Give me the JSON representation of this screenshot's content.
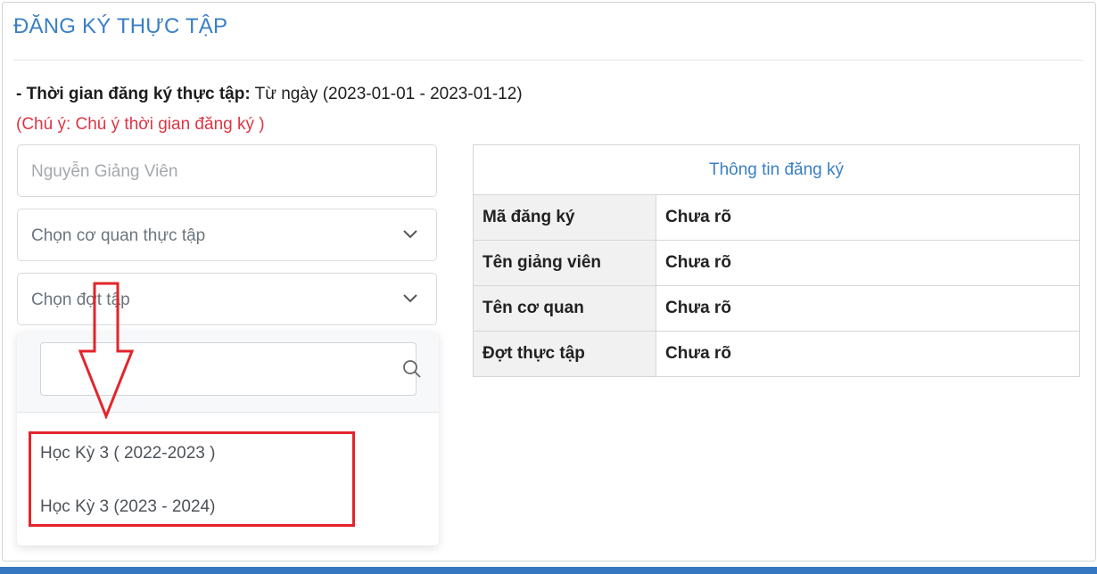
{
  "page": {
    "title": "ĐĂNG KÝ THỰC TẬP",
    "period_label": "- Thời gian đăng ký thực tập:",
    "period_value": "Từ ngày (2023-01-01 - 2023-01-12)",
    "note": "(Chú ý: Chú ý thời gian đăng ký )"
  },
  "form": {
    "lecturer_name": "Nguyễn Giảng Viên",
    "agency_select": "Chọn cơ quan thực tập",
    "batch_select": "Chọn đợt tập"
  },
  "dropdown": {
    "search_value": "",
    "options": [
      "Học Kỳ 3 ( 2022-2023 )",
      "Học Kỳ 3 (2023 - 2024)"
    ]
  },
  "info_table": {
    "header": "Thông tin đăng ký",
    "rows": [
      {
        "key": "Mã đăng ký",
        "value": "Chưa rõ"
      },
      {
        "key": "Tên giảng viên",
        "value": "Chưa rõ"
      },
      {
        "key": "Tên cơ quan",
        "value": "Chưa rõ"
      },
      {
        "key": "Đợt thực tập",
        "value": "Chưa rõ"
      }
    ]
  },
  "icons": {
    "dropdown_chevron": "chevron-down-icon",
    "search": "search-icon",
    "annotation_arrow": "arrow-down-icon"
  },
  "colors": {
    "title_blue": "#3a7fc6",
    "note_red": "#dc3545",
    "annotation_red": "#e3242b",
    "footer_blue": "#3577c0"
  }
}
